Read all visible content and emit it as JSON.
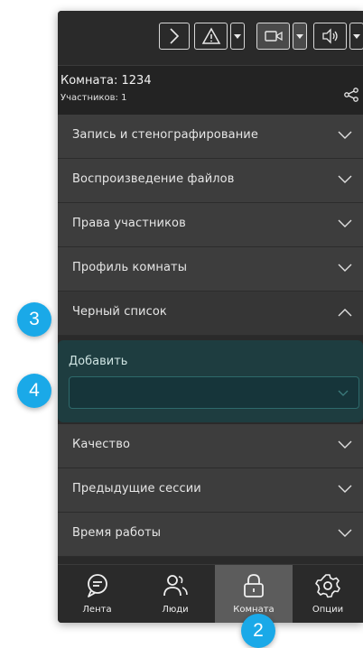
{
  "room": {
    "title": "Комната: 1234",
    "participants": "Участников: 1"
  },
  "sections": [
    {
      "label": "Запись и стенографирование",
      "expanded": false
    },
    {
      "label": "Воспроизведение файлов",
      "expanded": false
    },
    {
      "label": "Права участников",
      "expanded": false
    },
    {
      "label": "Профиль комнаты",
      "expanded": false
    },
    {
      "label": "Черный список",
      "expanded": true
    },
    {
      "label": "Качество",
      "expanded": false
    },
    {
      "label": "Предыдущие сессии",
      "expanded": false
    },
    {
      "label": "Время работы",
      "expanded": false
    }
  ],
  "blacklist": {
    "add_label": "Добавить",
    "input_value": ""
  },
  "nav": [
    {
      "label": "Лента",
      "icon": "chat-icon",
      "active": false
    },
    {
      "label": "Люди",
      "icon": "people-icon",
      "active": false
    },
    {
      "label": "Комната",
      "icon": "lock-icon",
      "active": true
    },
    {
      "label": "Опции",
      "icon": "gear-icon",
      "active": false
    }
  ],
  "callouts": [
    "2",
    "3",
    "4"
  ],
  "colors": {
    "accent": "#1aa9e8",
    "panel": "#2a2a2a",
    "section": "#3d3d3d",
    "blacklist_bg": "#1e3d40",
    "active_nav": "#5c5c5c"
  }
}
